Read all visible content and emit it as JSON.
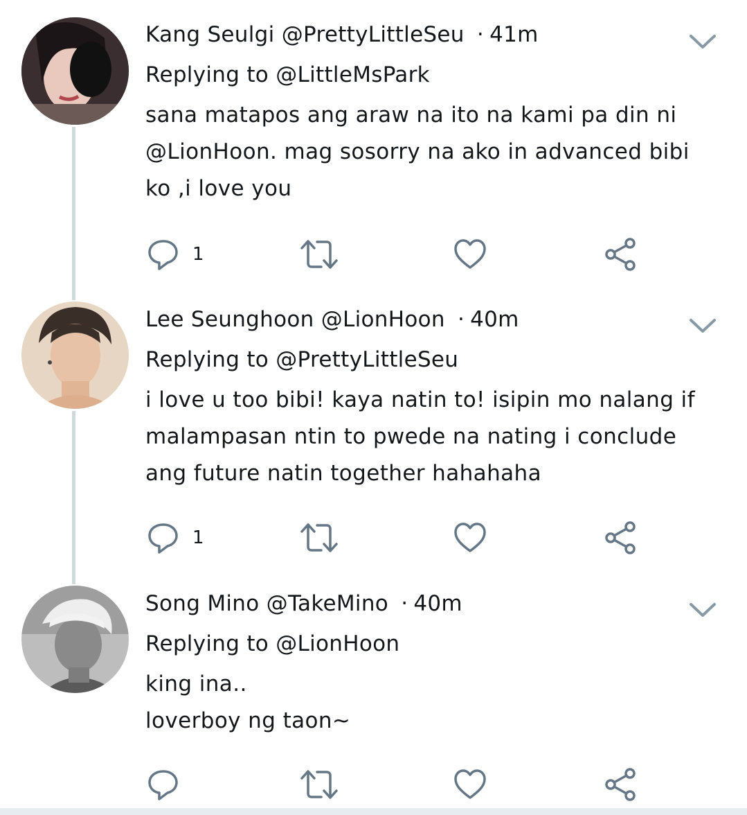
{
  "tweets": [
    {
      "name": "Kang Seulgi",
      "handle": "@PrettyLittleSeu",
      "separator": "·",
      "time": "41m",
      "reply_to": "Replying to @LittleMsPark",
      "text": "sana matapos ang araw na ito na kami pa din ni\n@LionHoon. mag sosorry na ako in advanced bibi\nko ,i love you",
      "reply_count": "1"
    },
    {
      "name": "Lee Seunghoon",
      "handle": "@LionHoon",
      "separator": "·",
      "time": "40m",
      "reply_to": "Replying to @PrettyLittleSeu",
      "text": "i love u too bibi! kaya natin to! isipin mo nalang if\nmalampasan ntin to pwede na nating i conclude\nang future natin together hahahaha",
      "reply_count": "1"
    },
    {
      "name": "Song Mino",
      "handle": "@TakeMino",
      "separator": "·",
      "time": "40m",
      "reply_to": "Replying to @LionHoon",
      "text": "king ina..\nloverboy ng taon~",
      "reply_count": ""
    }
  ],
  "icons": {
    "reply": "reply-icon",
    "retweet": "retweet-icon",
    "like": "heart-icon",
    "share": "share-icon",
    "menu": "chevron-down-icon"
  },
  "colors": {
    "icon": "#657786",
    "thread_line": "#cfd9de",
    "text": "#14171a"
  }
}
